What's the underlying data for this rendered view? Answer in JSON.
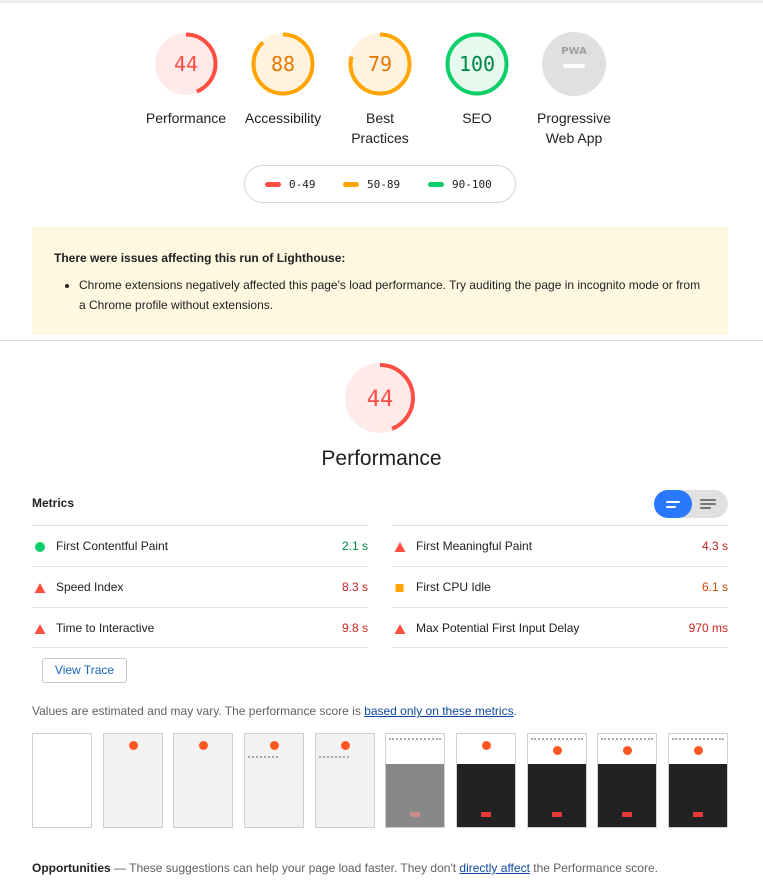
{
  "scores": [
    {
      "value": "44",
      "label": "Performance",
      "color": "#ff4e42",
      "bg": "#ffeaea",
      "fraction": 0.44
    },
    {
      "value": "88",
      "label": "Accessibility",
      "color": "#ffa400",
      "bg": "#fff3e0",
      "fraction": 0.88
    },
    {
      "value": "79",
      "label_line1": "Best",
      "label_line2": "Practices",
      "color": "#ffa400",
      "bg": "#fff3e0",
      "fraction": 0.79
    },
    {
      "value": "100",
      "label": "SEO",
      "color": "#0cce6b",
      "bg": "#e6f9ee",
      "fraction": 1.0
    },
    {
      "badge": "PWA",
      "label_line1": "Progressive",
      "label_line2": "Web App",
      "color": "#bdbdbd"
    }
  ],
  "legend": [
    {
      "range": "0-49",
      "color": "#ff4e42"
    },
    {
      "range": "50-89",
      "color": "#ffa400"
    },
    {
      "range": "90-100",
      "color": "#0cce6b"
    }
  ],
  "warning": {
    "title": "There were issues affecting this run of Lighthouse:",
    "item": "Chrome extensions negatively affected this page's load performance. Try auditing the page in incognito mode or from a Chrome profile without extensions."
  },
  "performance": {
    "score": "44",
    "score_fraction": 0.44,
    "title": "Performance"
  },
  "metrics": {
    "heading": "Metrics",
    "left": [
      {
        "name": "First Contentful Paint",
        "value": "2.1 s",
        "status": "pass",
        "color": "#018642"
      },
      {
        "name": "Speed Index",
        "value": "8.3 s",
        "status": "fail",
        "color": "#c7221f"
      },
      {
        "name": "Time to Interactive",
        "value": "9.8 s",
        "status": "fail",
        "color": "#c7221f"
      }
    ],
    "right": [
      {
        "name": "First Meaningful Paint",
        "value": "4.3 s",
        "status": "fail",
        "color": "#c7221f"
      },
      {
        "name": "First CPU Idle",
        "value": "6.1 s",
        "status": "average",
        "color": "#d04900"
      },
      {
        "name": "Max Potential First Input Delay",
        "value": "970 ms",
        "status": "fail",
        "color": "#c7221f"
      }
    ]
  },
  "view_trace": "View Trace",
  "note": {
    "text": "Values are estimated and may vary. The performance score is ",
    "link": "based only on these metrics",
    "end": "."
  },
  "opportunities": {
    "title": "Opportunities",
    "text": " — These suggestions can help your page load faster. They don't ",
    "link": "directly affect",
    "end": " the Performance score."
  }
}
